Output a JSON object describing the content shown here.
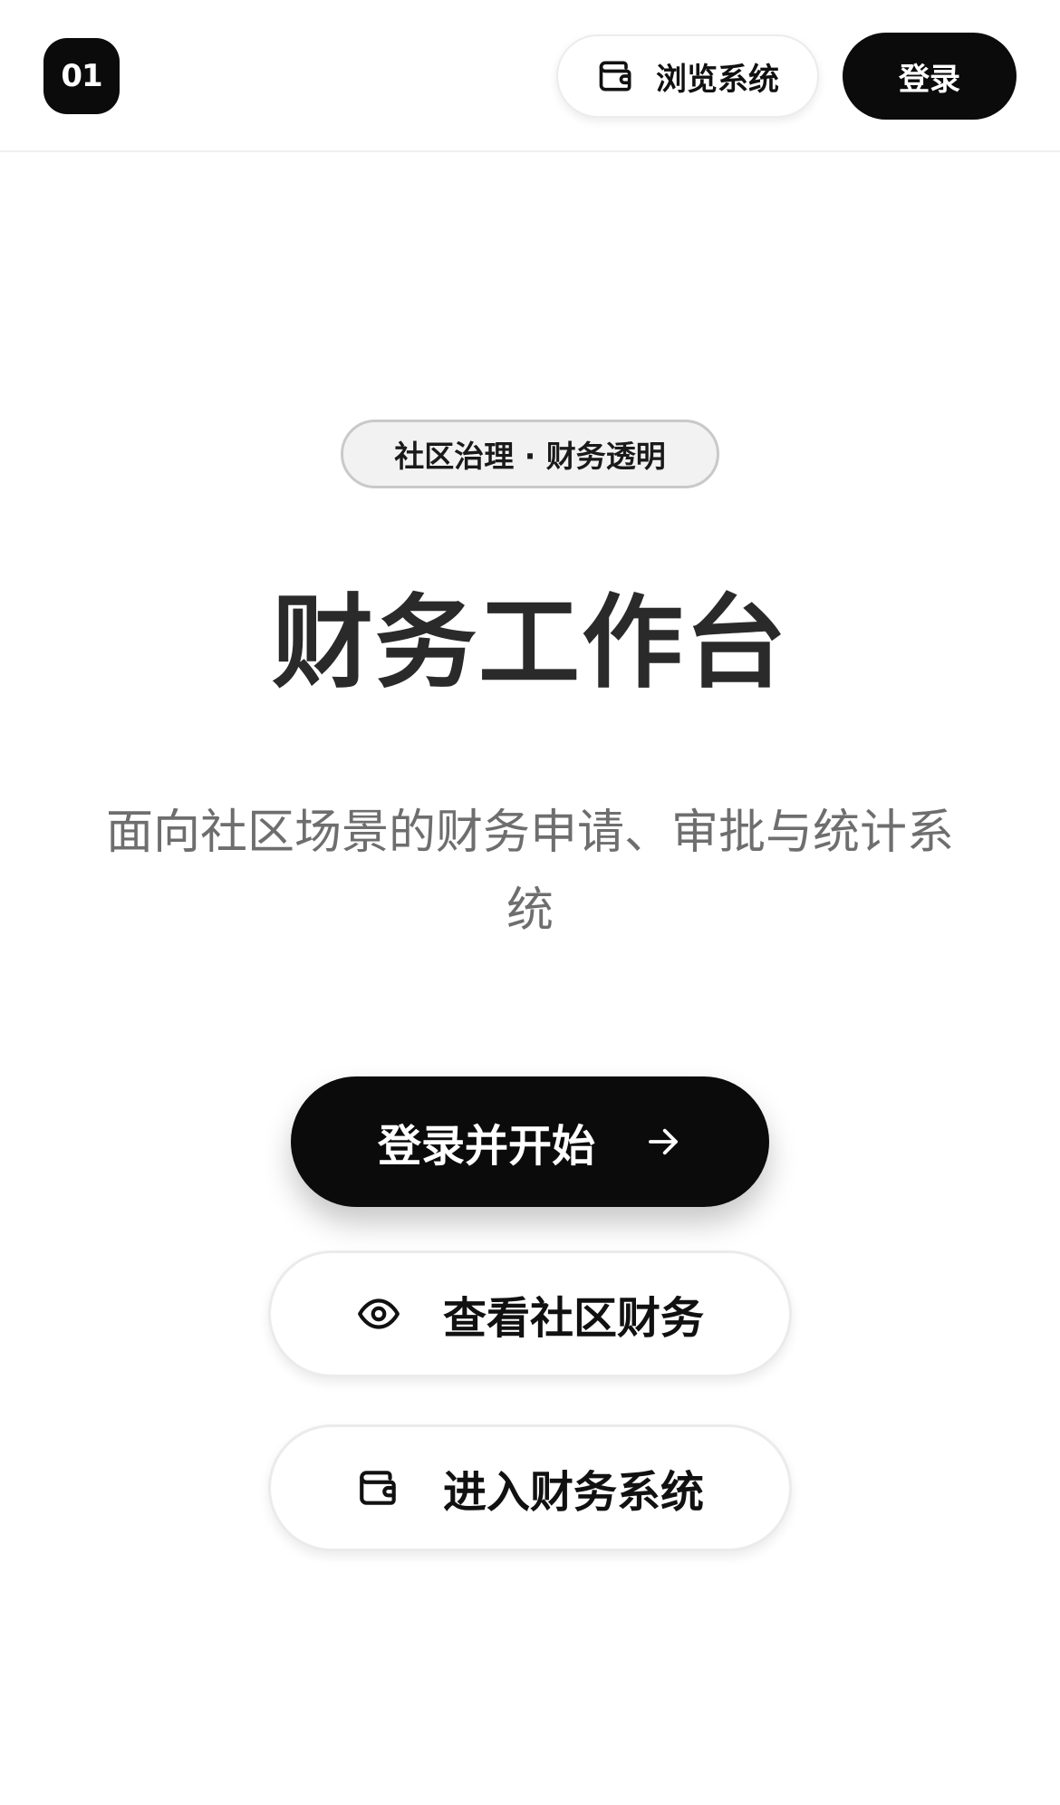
{
  "header": {
    "logo_text": "01",
    "browse_label": "浏览系统",
    "browse_icon": "wallet-icon",
    "login_label": "登录"
  },
  "hero": {
    "badge": "社区治理 · 财务透明",
    "title": "财务工作台",
    "subtitle": "面向社区场景的财务申请、审批与统计系统"
  },
  "actions": {
    "primary_label": "登录并开始",
    "primary_icon": "arrow-right-icon",
    "view_label": "查看社区财务",
    "view_icon": "eye-icon",
    "enter_label": "进入财务系统",
    "enter_icon": "wallet-icon"
  },
  "colors": {
    "primary": "#0b0b0b",
    "background": "#ffffff",
    "muted_text": "#6e6e6e"
  }
}
